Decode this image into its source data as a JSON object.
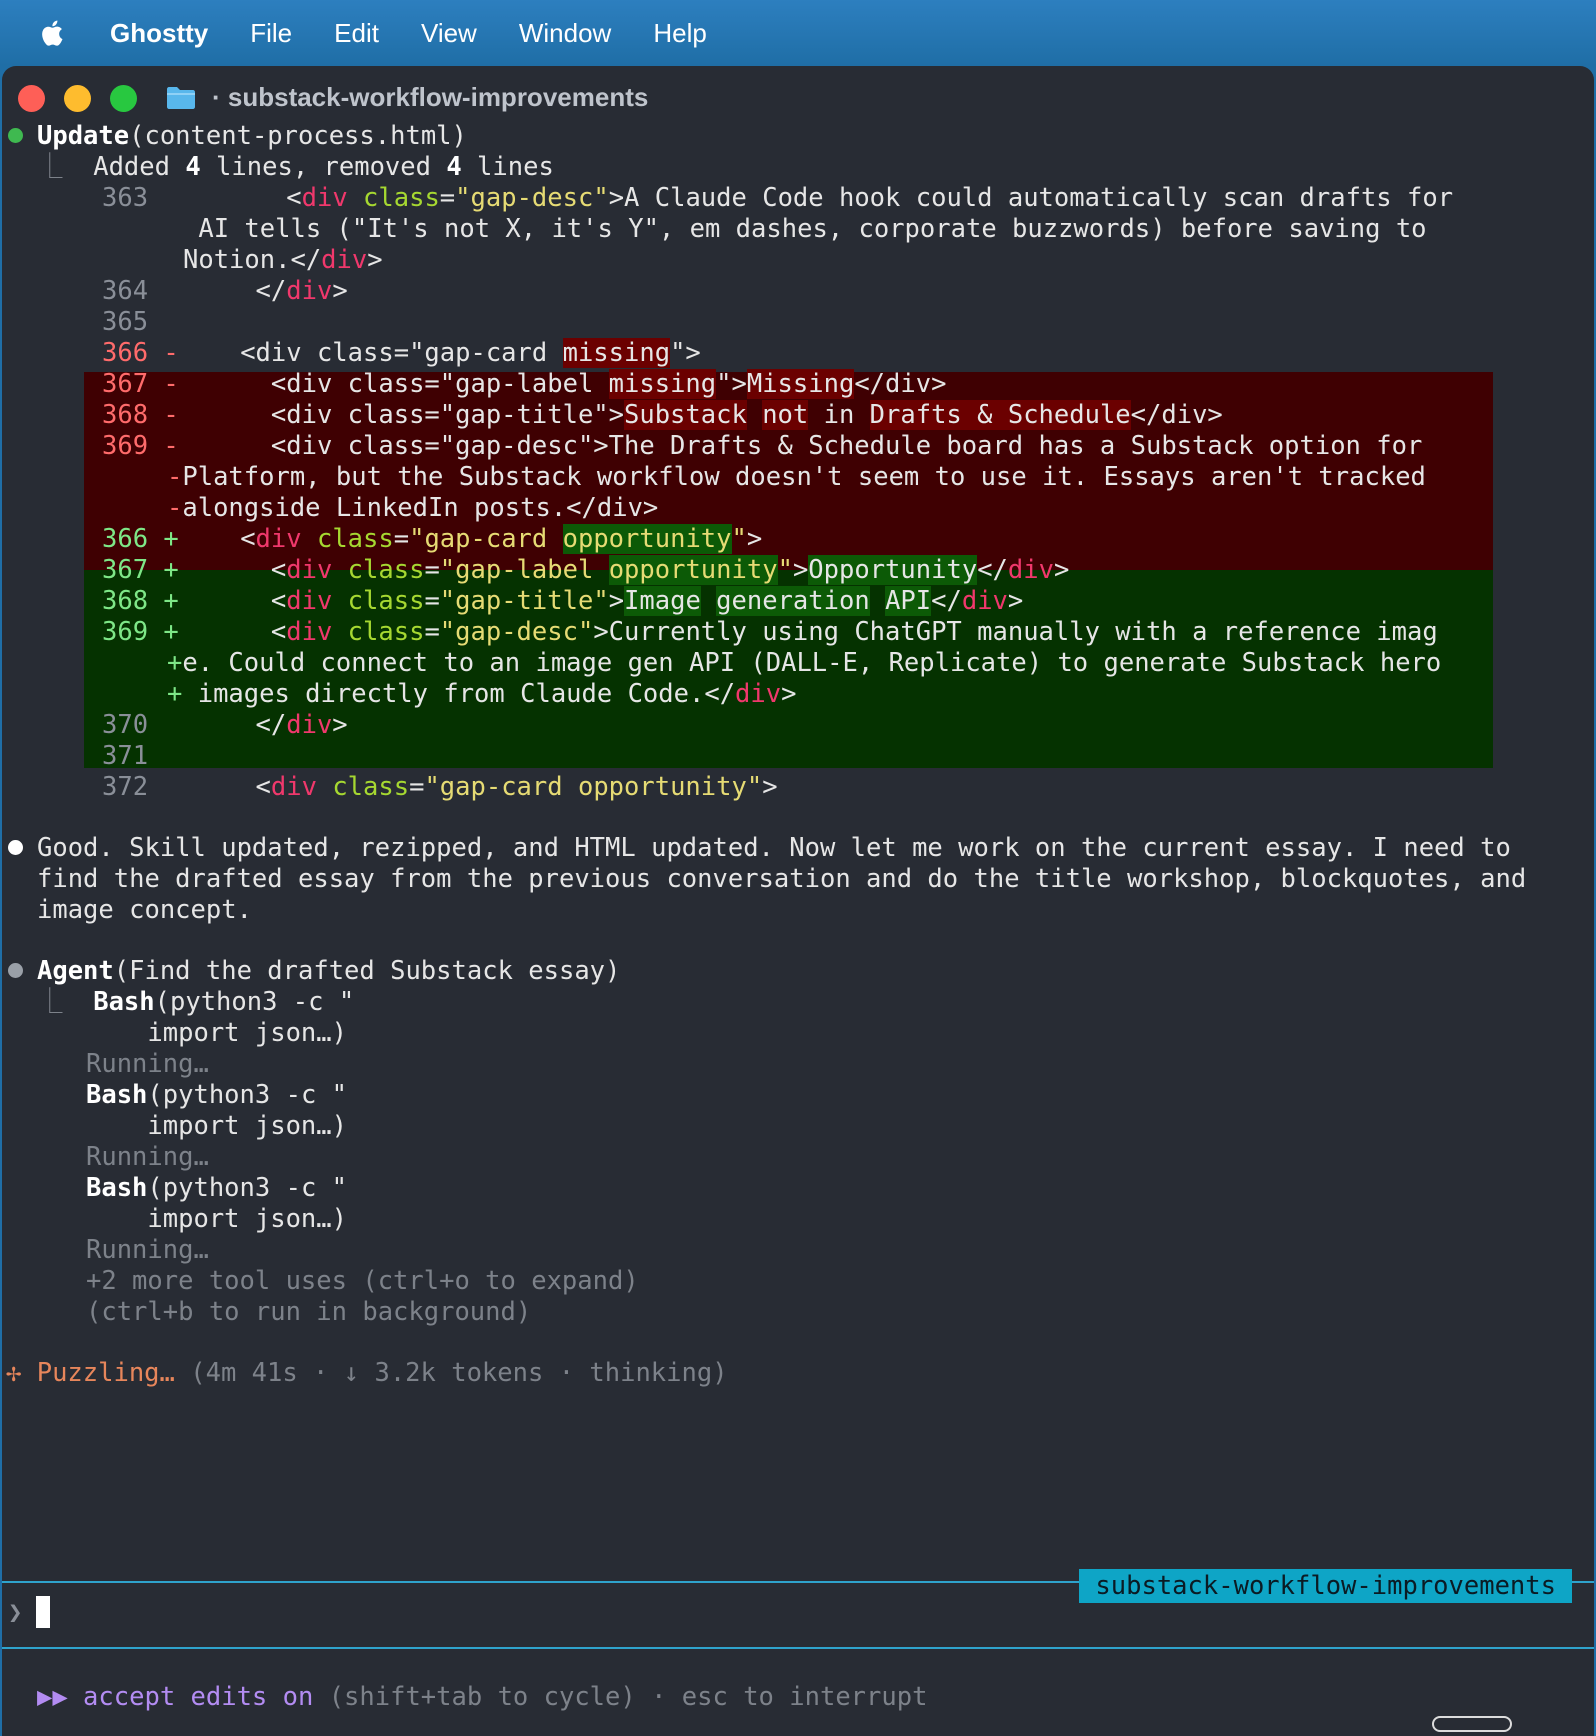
{
  "menubar": {
    "app": "Ghostty",
    "items": [
      "File",
      "Edit",
      "View",
      "Window",
      "Help"
    ]
  },
  "window": {
    "title": "· substack-workflow-improvements"
  },
  "update": {
    "tool": "Update",
    "arg": "(content-process.html)",
    "summary_pre": "Added ",
    "added": "4",
    "summary_mid": " lines, removed ",
    "removed": "4",
    "summary_post": " lines"
  },
  "diff": {
    "l363_num": "363",
    "l363_indent": "      ",
    "l363_attr_val": "\"gap-desc\"",
    "l363_text": ">A Claude Code hook could automatically scan drafts for",
    "l363_w1": " AI tells (\"It's not X, it's Y\", em dashes, corporate buzzwords) before saving to",
    "l363_w2": "Notion.</",
    "l364_num": "364",
    "l364_indent": "    ",
    "l365_num": "365",
    "tag_div": "div",
    "attr_class": "class",
    "del1_num": "366",
    "del1_pre": "    <div class=\"gap-card ",
    "del1_hl": "missing",
    "del1_post": "\">",
    "del2_num": "367",
    "del2_pre": "      <div class=\"gap-label ",
    "del2_hl1": "missing",
    "del2_mid": "\">",
    "del2_hl2": "Missing",
    "del2_post": "</div>",
    "del3_num": "368",
    "del3_pre": "      <div class=\"gap-title\">",
    "del3_hl1": "Substack",
    "del3_sp": " ",
    "del3_hl2": "not",
    "del3_mid": " in ",
    "del3_hl3": "Drafts & Schedule",
    "del3_post": "</div>",
    "del4_num": "369",
    "del4_text": "      <div class=\"gap-desc\">The Drafts & Schedule board has a Substack option for",
    "del4_w1": "Platform, but the Substack workflow doesn't seem to use it. Essays aren't tracked",
    "del4_w2": "alongside LinkedIn posts.</div>",
    "add1_num": "366",
    "add1_hl": "opportunity",
    "add2_num": "367",
    "add2_hl1": "opportunity",
    "add2_hl2": "Opportunity",
    "add3_num": "368",
    "add3_hl1": "Image",
    "add3_hl2": "generation",
    "add3_hl3": "API",
    "add4_num": "369",
    "add4_text": ">Currently using ChatGPT manually with a reference imag",
    "add4_w1": "e. Could connect to an image gen API (DALL-E, Replicate) to generate Substack hero",
    "add4_w2": " images directly from Claude Code.</",
    "l370_num": "370",
    "l371_num": "371",
    "l372_num": "372",
    "l372_val": "\"gap-card opportunity\"",
    "minus": "-",
    "plus": "+"
  },
  "message": {
    "line1": "Good. Skill updated, rezipped, and HTML updated. Now let me work on the current essay. I need to",
    "line2": "find the drafted essay from the previous conversation and do the title workshop, blockquotes, and",
    "line3": "image concept."
  },
  "agent": {
    "tool": "Agent",
    "arg": "(Find the drafted Substack essay)",
    "bash_label": "Bash",
    "bash_arg": "(python3 -c \"",
    "bash_cont": "    import json…)",
    "running": "Running…",
    "more": "+2 more tool uses (ctrl+o to expand)",
    "background": "(ctrl+b to run in background)"
  },
  "status": {
    "spinner": "✢",
    "verb": "Puzzling…",
    "detail": " (4m 41s · ↓ 3.2k tokens · thinking)"
  },
  "branch": "substack-workflow-improvements",
  "prompt_symbol": "❯",
  "footer": {
    "mode": "▶▶ accept edits on",
    "hint": " (shift+tab to cycle) · esc to interrupt"
  },
  "colors": {
    "tag": "#f0386c",
    "attr": "#a6d831",
    "string": "#e6db74",
    "deleted_bg": "#3f0002",
    "added_bg": "#053200",
    "accent": "#2fa3cc"
  }
}
